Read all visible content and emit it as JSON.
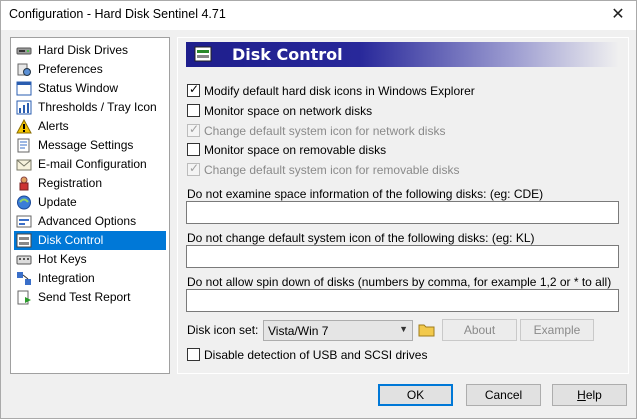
{
  "window": {
    "title": "Configuration  -  Hard Disk Sentinel 4.71",
    "close_glyph": "✕"
  },
  "sidebar": {
    "items": [
      {
        "label": "Hard Disk Drives",
        "icon": "hard-disk-icon"
      },
      {
        "label": "Preferences",
        "icon": "preferences-icon"
      },
      {
        "label": "Status Window",
        "icon": "status-window-icon"
      },
      {
        "label": "Thresholds / Tray Icon",
        "icon": "thresholds-icon"
      },
      {
        "label": "Alerts",
        "icon": "alert-icon"
      },
      {
        "label": "Message Settings",
        "icon": "message-icon"
      },
      {
        "label": "E-mail Configuration",
        "icon": "email-icon"
      },
      {
        "label": "Registration",
        "icon": "registration-icon"
      },
      {
        "label": "Update",
        "icon": "update-icon"
      },
      {
        "label": "Advanced Options",
        "icon": "advanced-options-icon"
      },
      {
        "label": "Disk Control",
        "icon": "disk-control-icon",
        "selected": true
      },
      {
        "label": "Hot Keys",
        "icon": "hot-keys-icon"
      },
      {
        "label": "Integration",
        "icon": "integration-icon"
      },
      {
        "label": "Send Test Report",
        "icon": "send-report-icon"
      }
    ]
  },
  "panel": {
    "title": "Disk Control",
    "checkboxes": [
      {
        "label": "Modify default hard disk icons in Windows Explorer",
        "checked": true,
        "disabled": false
      },
      {
        "label": "Monitor space on network disks",
        "checked": false,
        "disabled": false
      },
      {
        "label": "Change default system icon for network disks",
        "checked": true,
        "disabled": true
      },
      {
        "label": "Monitor space on removable disks",
        "checked": false,
        "disabled": false
      },
      {
        "label": "Change default system icon for removable disks",
        "checked": true,
        "disabled": true
      }
    ],
    "fields": [
      {
        "label": "Do not examine space information of the following disks: (eg: CDE)",
        "value": ""
      },
      {
        "label": "Do not change default system icon of the following disks: (eg: KL)",
        "value": ""
      },
      {
        "label": "Do not allow spin down of disks (numbers by comma, for example 1,2 or * to all)",
        "value": ""
      }
    ],
    "icon_set": {
      "label": "Disk icon set:",
      "value": "Vista/Win 7"
    },
    "about_label": "About",
    "example_label": "Example",
    "usb_checkbox": {
      "label": "Disable detection of USB and SCSI drives",
      "checked": false
    }
  },
  "footer": {
    "ok": "OK",
    "cancel": "Cancel",
    "help_prefix": "",
    "help_u": "H",
    "help_rest": "elp"
  },
  "colors": {
    "selection": "#0078d7",
    "header_dark": "#1e1e8c"
  }
}
